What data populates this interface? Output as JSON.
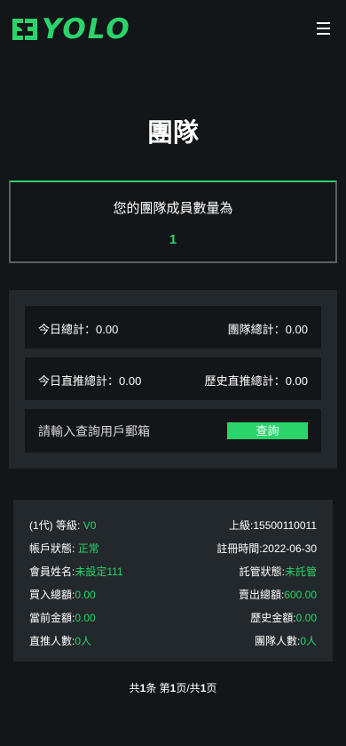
{
  "header": {
    "brand_text": "YOLO",
    "logo_icon": "bird-logo-icon",
    "menu_icon": "hamburger-menu-icon"
  },
  "page_title": "團隊",
  "team_count": {
    "label": "您的團隊成員數量為",
    "value": "1"
  },
  "stats": {
    "today_total_label": "今日總計：",
    "today_total_value": "0.00",
    "team_total_label": "團隊總計：",
    "team_total_value": "0.00",
    "today_direct_label": "今日直推總計：",
    "today_direct_value": "0.00",
    "history_direct_label": "歷史直推總計：",
    "history_direct_value": "0.00"
  },
  "search": {
    "placeholder": "請輸入查詢用戶郵箱",
    "button_label": "查詢"
  },
  "member": {
    "generation": "(1代)",
    "level_label": "等級:",
    "level_value": "V0",
    "superior_label": "上級:",
    "superior_value": "15500110011",
    "status_label": "帳戶狀態:",
    "status_value": "正常",
    "reg_time_label": "註冊時間:",
    "reg_time_value": "2022-06-30",
    "name_label": "會員姓名:",
    "name_value": "未設定111",
    "custody_label": "託管狀態:",
    "custody_value": "未託管",
    "buy_total_label": "買入總額:",
    "buy_total_value": "0.00",
    "sell_total_label": "賣出總額:",
    "sell_total_value": "600.00",
    "current_amount_label": "當前金額:",
    "current_amount_value": "0.00",
    "history_amount_label": "歷史金額:",
    "history_amount_value": "0.00",
    "direct_count_label": "直推人數:",
    "direct_count_value": "0人",
    "team_count_label": "團隊人數:",
    "team_count_value": "0人"
  },
  "pagination": {
    "prefix": "共",
    "total": "1",
    "unit_total": "条 第",
    "page": "1",
    "sep": "页/共",
    "pages": "1",
    "suffix": "页"
  },
  "colors": {
    "accent": "#2bd46b",
    "background": "#121619",
    "panel": "#23282c"
  }
}
